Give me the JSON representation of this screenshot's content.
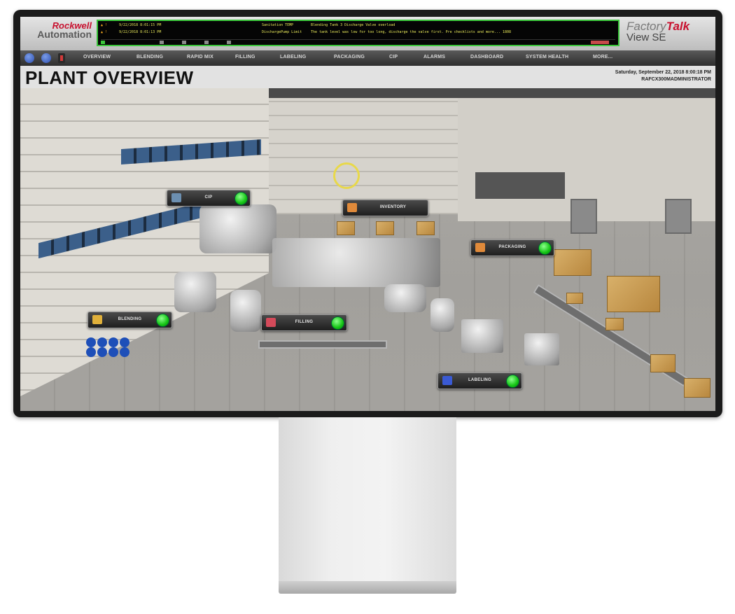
{
  "header": {
    "logo_line1": "Rockwell",
    "logo_line2": "Automation",
    "product_line1": "Factory",
    "product_line1_accent": "Talk",
    "product_line2": "View SE",
    "alarms": [
      {
        "severity": "▲ !",
        "time": "9/22/2018 8:01:15 PM",
        "tag": "Sanitation TEMP",
        "message": "Blending Tank 3 Discharge Valve overload"
      },
      {
        "severity": "▲ !",
        "time": "9/22/2018 8:01:13 PM",
        "tag": "DischargePump Limit",
        "message": "The tank level was low for too long, discharge the valve first. Pre checklists and more... 1808"
      }
    ]
  },
  "nav": {
    "items": [
      "OVERVIEW",
      "BLENDING",
      "RAPID MIX",
      "FILLING",
      "LABELING",
      "PACKAGING",
      "CIP",
      "ALARMS",
      "DASHBOARD",
      "SYSTEM HEALTH",
      "MORE..."
    ]
  },
  "title": {
    "page_title": "PLANT OVERVIEW",
    "datetime": "Saturday, September 22, 2018 8:00:18 PM",
    "user": "RAFCX300MADMINISTRATOR"
  },
  "areas": {
    "cip": {
      "label": "CIP",
      "icon": "cip-icon",
      "status_color": "#14c414"
    },
    "inventory": {
      "label": "INVENTORY",
      "icon": "inventory-icon"
    },
    "packaging": {
      "label": "PACKAGING",
      "icon": "packaging-icon",
      "status_color": "#14c414"
    },
    "blending": {
      "label": "BLENDING",
      "icon": "blending-icon",
      "status_color": "#14c414"
    },
    "filling": {
      "label": "FILLING",
      "icon": "filling-icon",
      "status_color": "#14c414"
    },
    "labeling": {
      "label": "LABELING",
      "icon": "labeling-icon",
      "status_color": "#14c414"
    }
  },
  "colors": {
    "alarm_border": "#3cc63c",
    "brand_red": "#c8102e",
    "status_green": "#14c414"
  }
}
